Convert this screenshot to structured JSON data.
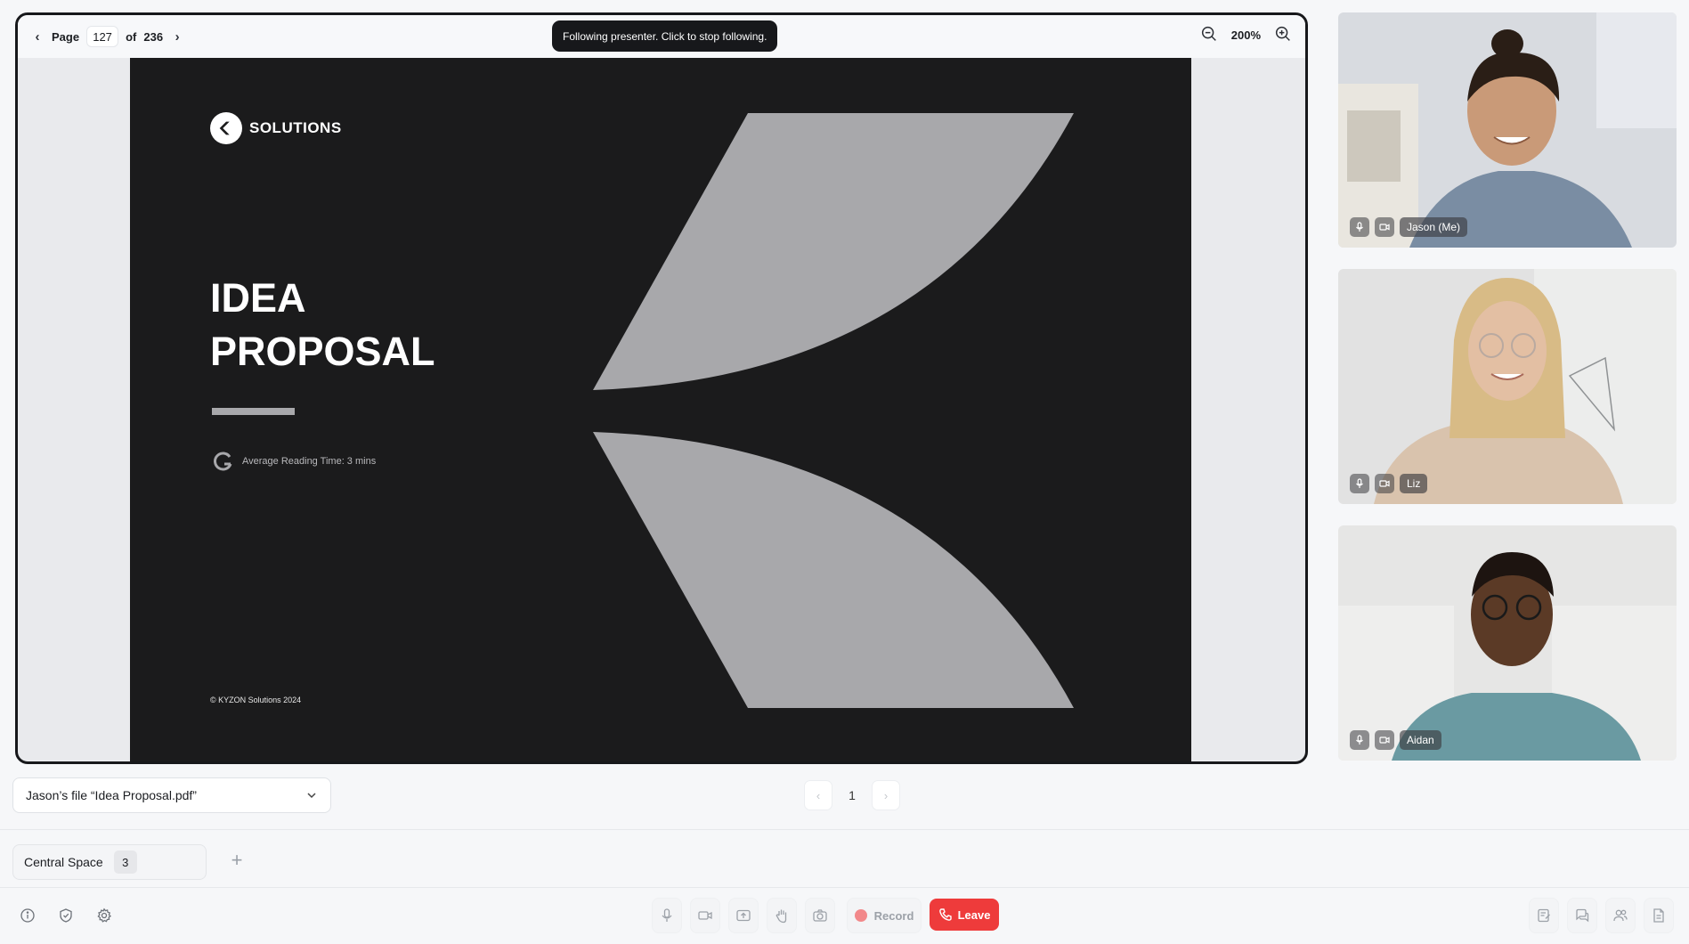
{
  "viewer": {
    "page_label": "Page",
    "current_page": "127",
    "of_label": "of",
    "total_pages": "236",
    "follow_toast": "Following presenter. Click to stop following.",
    "zoom_level": "200%"
  },
  "slide": {
    "logo_text": "SOLUTIONS",
    "title_line1": "IDEA",
    "title_line2": "PROPOSAL",
    "reading_time": "Average Reading Time: 3 mins",
    "copyright": "© KYZON Solutions 2024"
  },
  "participants": [
    {
      "name": "Jason (Me)"
    },
    {
      "name": "Liz"
    },
    {
      "name": "Aidan"
    }
  ],
  "file_select": {
    "value": "Jason’s file “Idea Proposal.pdf”"
  },
  "mini_pager": {
    "current": "1"
  },
  "space": {
    "name": "Central Space",
    "count": "3"
  },
  "controls": {
    "record_label": "Record",
    "leave_label": "Leave"
  },
  "colors": {
    "leave": "#ee3b3b",
    "slide_bg": "#1b1b1c",
    "slide_shape": "#a8a8ab"
  }
}
